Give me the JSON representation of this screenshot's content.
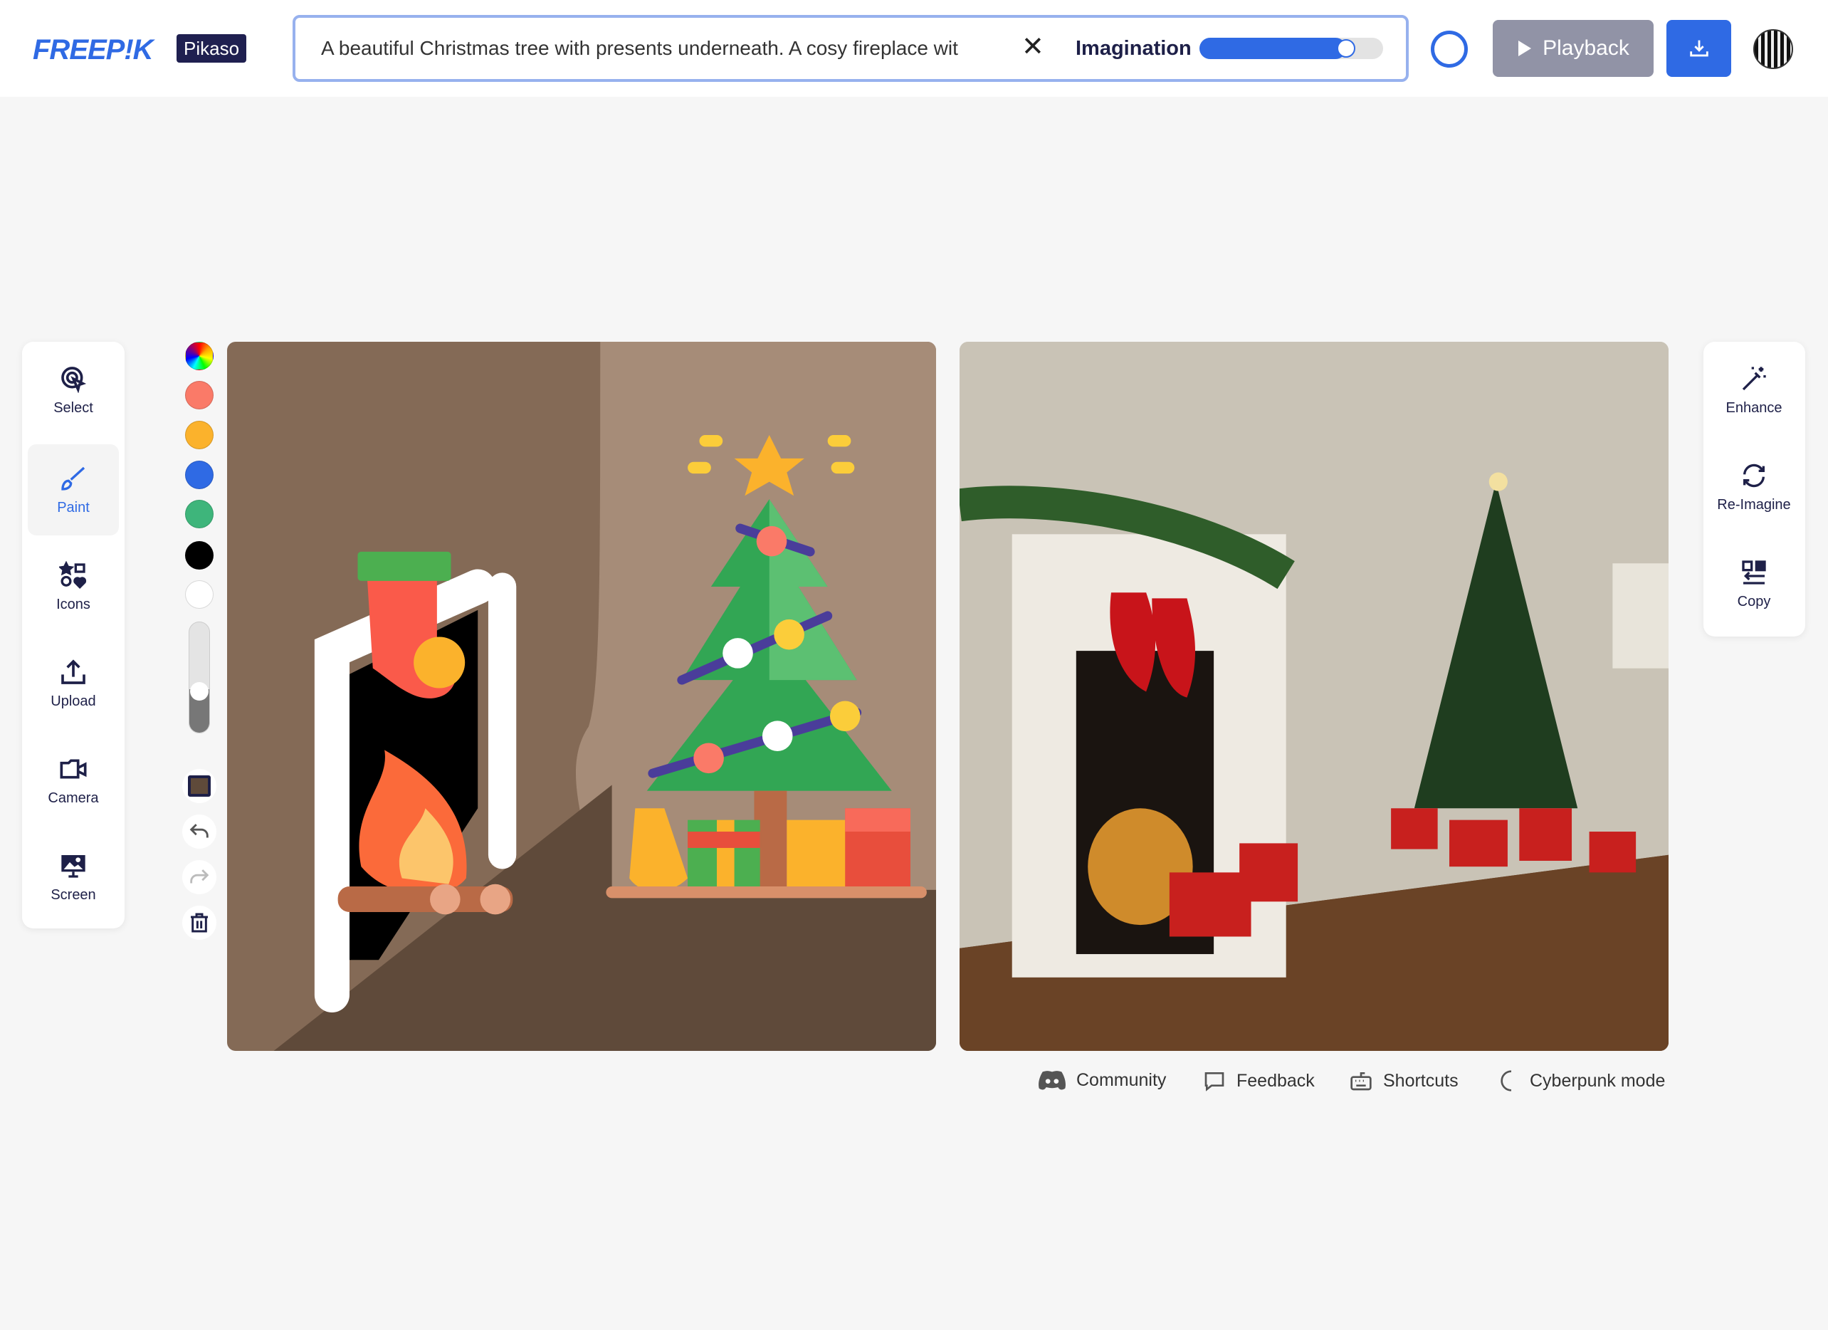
{
  "header": {
    "logo": "FREEP!K",
    "product": "Pikaso",
    "prompt": "A beautiful Christmas tree with presents underneath. A cosy fireplace wit",
    "imagination_label": "Imagination",
    "imagination_value": 0.75,
    "playback_label": "Playback"
  },
  "left_toolbar": {
    "items": [
      {
        "label": "Select",
        "icon": "select-cursor-icon"
      },
      {
        "label": "Paint",
        "icon": "brush-icon",
        "active": true
      },
      {
        "label": "Icons",
        "icon": "shapes-icon"
      },
      {
        "label": "Upload",
        "icon": "upload-icon"
      },
      {
        "label": "Camera",
        "icon": "camera-icon"
      },
      {
        "label": "Screen",
        "icon": "screen-icon"
      }
    ]
  },
  "palette": {
    "colors": [
      "#fa7a68",
      "#fbb22c",
      "#2f6ae4",
      "#3eb57b",
      "#000000",
      "#ffffff"
    ],
    "brush_size": 0.2,
    "background_color": "#5f4a3a"
  },
  "right_toolbar": {
    "items": [
      {
        "label": "Enhance",
        "icon": "magic-wand-icon"
      },
      {
        "label": "Re-Imagine",
        "icon": "refresh-icon"
      },
      {
        "label": "Copy",
        "icon": "copy-icon"
      }
    ]
  },
  "footer": {
    "community": "Community",
    "feedback": "Feedback",
    "shortcuts": "Shortcuts",
    "cyberpunk": "Cyberpunk mode"
  },
  "colors": {
    "accent": "#2f6ae4",
    "navy": "#1e2048"
  }
}
